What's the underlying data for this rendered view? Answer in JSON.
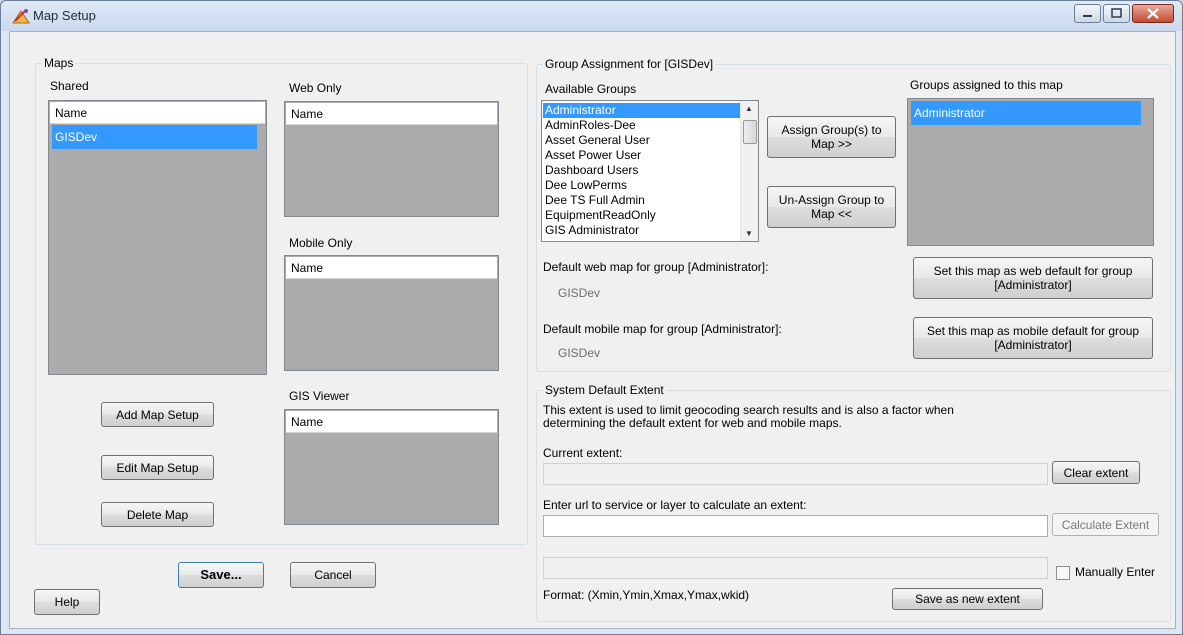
{
  "window": {
    "title": "Map Setup"
  },
  "maps": {
    "group_title": "Maps",
    "shared": {
      "label": "Shared",
      "column": "Name",
      "selected_item": "GISDev"
    },
    "web_only": {
      "label": "Web Only",
      "column": "Name"
    },
    "mobile_only": {
      "label": "Mobile Only",
      "column": "Name"
    },
    "gis_viewer": {
      "label": "GIS Viewer",
      "column": "Name"
    },
    "add_button": "Add Map Setup",
    "edit_button": "Edit Map Setup",
    "delete_button": "Delete Map"
  },
  "group_assignment": {
    "title": "Group Assignment for [GISDev]",
    "available_label": "Available Groups",
    "available_groups": [
      "Administrator",
      "AdminRoles-Dee",
      "Asset General User",
      "Asset Power User",
      "Dashboard Users",
      "Dee LowPerms",
      "Dee TS Full Admin",
      "EquipmentReadOnly",
      "GIS Administrator"
    ],
    "selected_available": "Administrator",
    "assign_button": "Assign Group(s) to Map >>",
    "unassign_button": "Un-Assign Group to Map <<",
    "assigned_label": "Groups assigned to this map",
    "assigned_groups": [
      "Administrator"
    ],
    "default_web_label": "Default web map for group [Administrator]:",
    "default_web_value": "GISDev",
    "set_web_button": "Set this map as web default for group [Administrator]",
    "default_mobile_label": "Default mobile map for group [Administrator]:",
    "default_mobile_value": "GISDev",
    "set_mobile_button": "Set this map as mobile default for group [Administrator]"
  },
  "extent": {
    "title": "System Default Extent",
    "description": "This extent is used to limit geocoding search results and is also a factor when determining the default extent for web and mobile maps.",
    "current_label": "Current extent:",
    "current_value": "",
    "clear_button": "Clear extent",
    "url_label": "Enter url to service or layer to calculate an extent:",
    "url_value": "",
    "calculate_button": "Calculate Extent",
    "manual_value": "",
    "manual_checkbox_label": "Manually Enter",
    "manual_checked": false,
    "format_label": "Format: (Xmin,Ymin,Xmax,Ymax,wkid)",
    "save_extent_button": "Save as new extent"
  },
  "footer": {
    "save_button": "Save...",
    "cancel_button": "Cancel",
    "help_button": "Help"
  }
}
